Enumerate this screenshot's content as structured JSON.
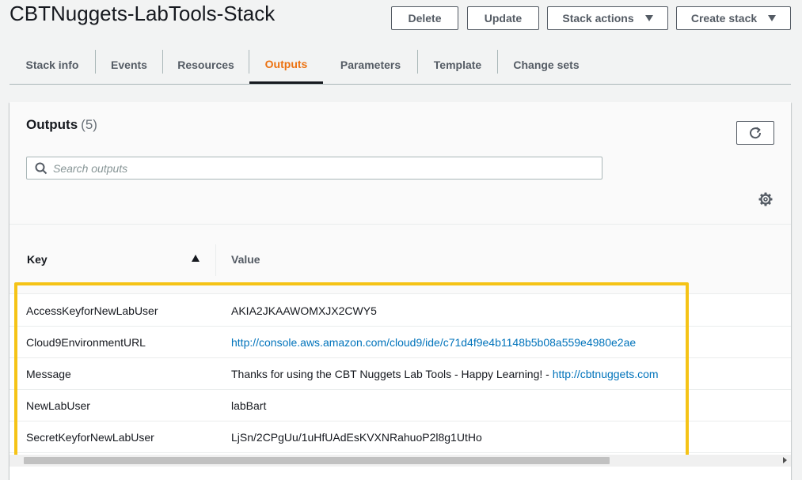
{
  "page": {
    "title": "CBTNuggets-LabTools-Stack"
  },
  "header_buttons": {
    "delete": "Delete",
    "update": "Update",
    "stack_actions": "Stack actions",
    "create_stack": "Create stack"
  },
  "tabs": [
    {
      "label": "Stack info",
      "active": false
    },
    {
      "label": "Events",
      "active": false
    },
    {
      "label": "Resources",
      "active": false
    },
    {
      "label": "Outputs",
      "active": true
    },
    {
      "label": "Parameters",
      "active": false
    },
    {
      "label": "Template",
      "active": false
    },
    {
      "label": "Change sets",
      "active": false
    }
  ],
  "outputs": {
    "title": "Outputs",
    "count": "(5)",
    "search_placeholder": "Search outputs",
    "search_value": "",
    "columns": {
      "key": "Key",
      "value": "Value"
    },
    "sort": "ascending",
    "rows": [
      {
        "key": "AccessKeyforNewLabUser",
        "value": "AKIA2JKAAWOMXJX2CWY5"
      },
      {
        "key": "Cloud9EnvironmentURL",
        "value_link": "http://console.aws.amazon.com/cloud9/ide/c71d4f9e4b1148b5b08a559e4980e2ae"
      },
      {
        "key": "Message",
        "value": "Thanks for using the CBT Nuggets Lab Tools - Happy Learning! - ",
        "value_link": "http://cbtnuggets.com"
      },
      {
        "key": "NewLabUser",
        "value": "labBart"
      },
      {
        "key": "SecretKeyforNewLabUser",
        "value": "LjSn/2CPgUu/1uHfUAdEsKVXNRahuoP2l8g1UtHo"
      }
    ]
  },
  "colors": {
    "accent": "#ec7211",
    "link": "#0073bb",
    "highlight": "#f5c316",
    "text": "#16191f"
  },
  "icons": {
    "search": "search-icon",
    "refresh": "refresh-icon",
    "settings": "gear-icon",
    "sort": "sort-ascending-icon",
    "dropdown": "caret-down-icon"
  }
}
